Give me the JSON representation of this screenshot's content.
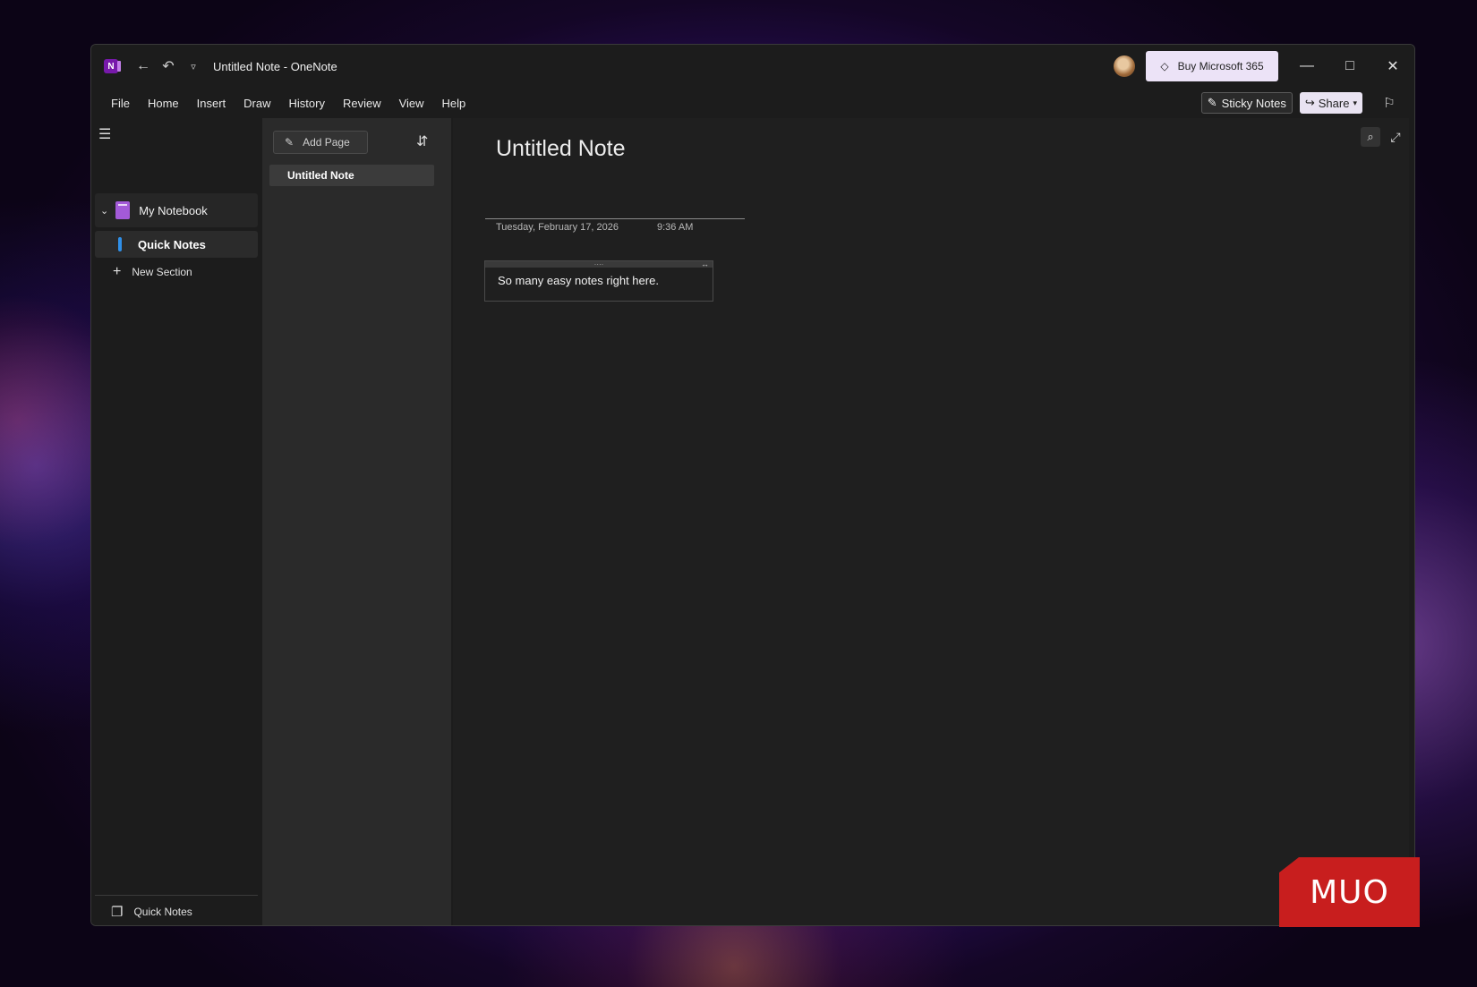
{
  "titlebar": {
    "title": "Untitled Note  -  OneNote",
    "app_icon": "N",
    "buy_label": "Buy Microsoft 365",
    "icons": [
      "back-icon",
      "undo-icon",
      "customize-toolbar-icon"
    ]
  },
  "menu": {
    "items": [
      "File",
      "Home",
      "Insert",
      "Draw",
      "History",
      "Review",
      "View",
      "Help"
    ],
    "sticky_notes_label": "Sticky Notes",
    "share_label": "Share"
  },
  "nav": {
    "notebook_label": "My Notebook",
    "section_label": "Quick Notes",
    "new_section_label": "New Section",
    "footer_label": "Quick Notes"
  },
  "pages": {
    "add_page_label": "Add Page",
    "items": [
      "Untitled Note"
    ]
  },
  "note": {
    "title": "Untitled Note",
    "date": "Tuesday, February 17, 2026",
    "time": "9:36 AM",
    "body": "So many easy notes right here."
  },
  "watermark": {
    "text": "MUO"
  },
  "colors": {
    "accent": "#7719aa",
    "section_tab": "#2f8fe8",
    "watermark": "#c81e1e"
  }
}
